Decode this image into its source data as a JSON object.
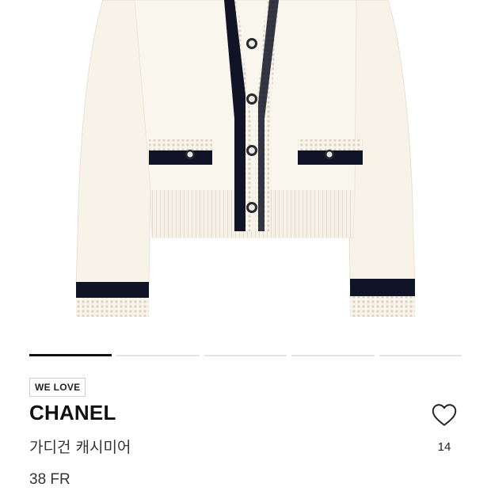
{
  "product": {
    "badge": "WE LOVE",
    "brand": "CHANEL",
    "name": "가디건 캐시미어",
    "size": "38 FR",
    "likes": "14"
  },
  "gallery": {
    "page_count": 5,
    "active_index": 0
  },
  "icons": {
    "like": "heart-outline-icon"
  },
  "colors": {
    "text": "#111111",
    "pager_active": "#111111",
    "pager_inactive": "#e4e4e4",
    "cardigan_body": "#f7f3e8",
    "cardigan_trim": "#101426"
  }
}
